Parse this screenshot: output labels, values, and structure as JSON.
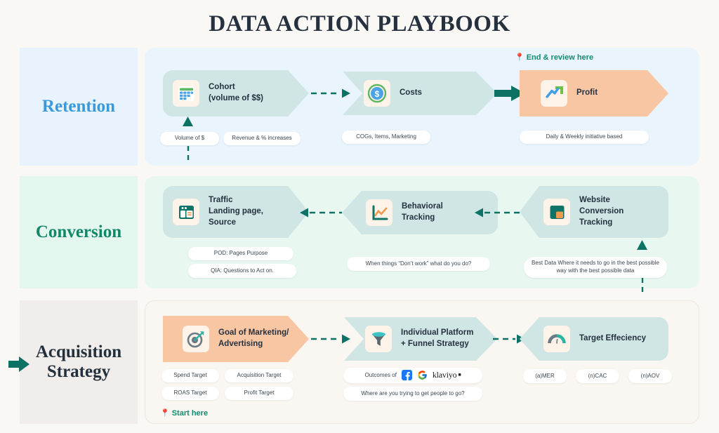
{
  "page": {
    "title": "DATA ACTION PLAYBOOK",
    "background": "#faf8f5"
  },
  "colors": {
    "retention_accent": "#3a9ad9",
    "conversion_accent": "#12876a",
    "acquisition_accent": "#23313e",
    "chevron_teal": "#cfe6e4",
    "chevron_peach": "#f8c6a3",
    "arrow_teal": "#0c7264",
    "marker_green": "#0e8c6e",
    "pin_red": "#e8483f"
  },
  "rows": [
    {
      "id": "retention",
      "label": "Retention",
      "nodes": [
        {
          "id": "cohort",
          "label": "Cohort\n(volume of $$)",
          "icon": "cohort-grid-icon",
          "style": "teal"
        },
        {
          "id": "costs",
          "label": "Costs",
          "icon": "dollar-coin-icon",
          "style": "teal"
        },
        {
          "id": "profit",
          "label": "Profit",
          "icon": "profit-trend-icon",
          "style": "peach"
        }
      ],
      "pills": [
        "Volume of $",
        "Revenue & % increases",
        "COGs, Items, Marketing",
        "Daily & Weekly  initiative based"
      ]
    },
    {
      "id": "conversion",
      "label": "Conversion",
      "nodes": [
        {
          "id": "traffic",
          "label": "Traffic\nLanding page,\nSource",
          "icon": "browser-window-icon",
          "style": "teal"
        },
        {
          "id": "behavioral",
          "label": "Behavioral\nTracking",
          "icon": "line-chart-icon",
          "style": "teal"
        },
        {
          "id": "website-conversion",
          "label": "Website\nConversion\nTracking",
          "icon": "layout-blocks-icon",
          "style": "teal"
        }
      ],
      "pills": [
        "POD: Pages Purpose",
        "QIA: Questions to Act on.",
        "When things “Don’t work” what do you do?",
        "Best Data Where it needs to go in the best possible way with the best possible data"
      ]
    },
    {
      "id": "acquisition",
      "label": "Acquisition\nStrategy",
      "nodes": [
        {
          "id": "goal",
          "label": "Goal of Marketing/\nAdvertising",
          "icon": "target-dart-icon",
          "style": "peach"
        },
        {
          "id": "platform-funnel",
          "label": "Individual Platform\n+ Funnel Strategy",
          "icon": "funnel-icon",
          "style": "teal"
        },
        {
          "id": "target-efficiency",
          "label": "Target Effeciency",
          "icon": "gauge-icon",
          "style": "teal"
        }
      ],
      "pills": [
        "Spend Target",
        "Acquisition Target",
        "ROAS Target",
        "Profit Target",
        "Where are you trying to get people to go?",
        "(a)MER",
        "(n)CAC",
        "(n)AOV"
      ],
      "brand_pill": {
        "prefix": "Outcomes of",
        "brands": [
          "facebook-icon",
          "google-icon",
          "klaviyo-wordmark"
        ],
        "klaviyo_text": "klaviyo"
      }
    }
  ],
  "markers": {
    "end": {
      "text": "End & review here",
      "pin": "📍"
    },
    "start": {
      "text": "Start here",
      "pin": "📍"
    }
  }
}
